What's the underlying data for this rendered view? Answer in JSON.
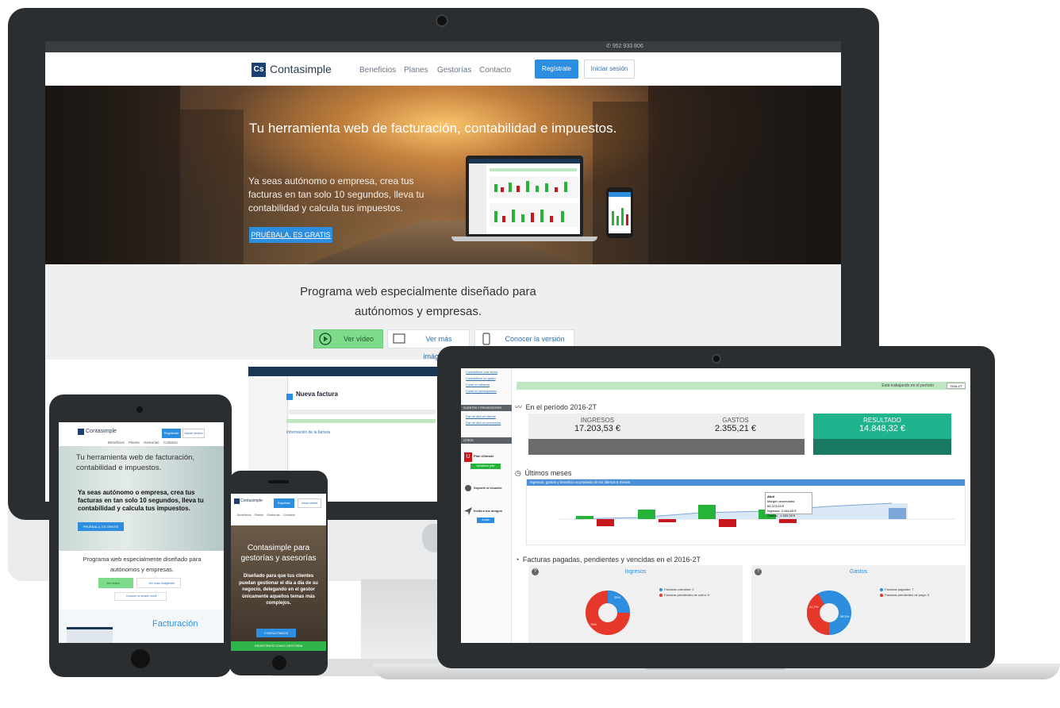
{
  "imac": {
    "top_phone": "952 933 806",
    "brand": "Contasimple",
    "logo_mark": "Cs",
    "nav": [
      "Beneficios",
      "Planes",
      "Gestorías",
      "Contacto"
    ],
    "register_label": "Regístrate",
    "login_label": "Iniciar sesión",
    "hero_title": "Tu herramienta web de facturación, contabilidad e impuestos.",
    "hero_sub": "Ya seas autónomo o empresa, crea tus facturas en tan solo 10 segundos, lleva tu contabilidad y calcula tus impuestos.",
    "hero_cta": "PRUÉBALA, ES GRATIS",
    "band_title_1": "Programa web especialmente diseñado para",
    "band_title_2": "autónomos y empresas.",
    "video_btn": "Ver vídeo",
    "images_btn": "Ver más imágenes",
    "mobile_btn": "Conocer la versión móvil",
    "invoice_title": "Nueva factura",
    "invoice_info": "Información de la factura"
  },
  "macbook": {
    "side_links": [
      "Contabilizar una venta",
      "Contabilizar un gasto",
      "Crear un albarán",
      "Crear un presupuesto"
    ],
    "side_head_clients": "CLIENTES Y PROVEEDORES",
    "side_links_2": [
      "Dar de alta un cliente",
      "Dar de alta un proveedor"
    ],
    "side_head_others": "OTROS",
    "plan_label": "Plan Ultimate",
    "plan_btn": "Actualizar plan",
    "support_label": "Soporte al Usuario",
    "invite_label": "Invita a tus amigos",
    "invite_btn": "Invitar",
    "period_bar": "Está trabajando en el período",
    "period_value": "2016-2T",
    "period_title": "En el período 2016-2T",
    "cards": [
      {
        "label": "INGRESOS",
        "value": "17.203,53 €"
      },
      {
        "label": "GASTOS",
        "value": "2.355,21 €"
      },
      {
        "label": "RESULTADO",
        "value": "14.848,32 €"
      }
    ],
    "months_title": "Últimos meses",
    "chart_title": "Ingresos, gastos y beneficio acumulado de los últimos 6 meses",
    "tooltip": {
      "month": "Abril",
      "l1": "Margen acumulado: 84.374,63 €",
      "l2": "Ingresos: 3.164,63 €",
      "l3": "Gastos: -1.009,00 €"
    },
    "invoices_title": "Facturas pagadas, pendientes y vencidas en el 2016-2T",
    "pie1": {
      "title": "Ingresos",
      "legend": [
        "Facturas cobradas: 2",
        "Facturas pendientes de cobro: 6"
      ],
      "label_a": "25%",
      "label_b": "75%"
    },
    "pie2": {
      "title": "Gastos",
      "legend": [
        "Facturas pagadas: 7",
        "Facturas pendientes de pago: 5"
      ],
      "label_a": "41,7%",
      "label_b": "58,3%"
    }
  },
  "tablet": {
    "brand": "Contasimple",
    "register_label": "Regístrate",
    "login_label": "Iniciar sesión",
    "nav": [
      "Beneficios",
      "Planes",
      "Gestorías",
      "Contacto"
    ],
    "hero_title": "Tu herramienta web de facturación, contabilidad e impuestos.",
    "hero_sub": "Ya seas autónomo o empresa, crea tus facturas en tan solo 10 segundos, lleva tu contabilidad y calcula tus impuestos.",
    "hero_cta": "PRUÉBALA, ES GRATIS",
    "band_title": "Programa web especialmente diseñado para autónomos y empresas.",
    "video_btn": "Ver vídeo",
    "images_btn": "Ver más imágenes",
    "mobile_btn": "Conocer la versión móvil",
    "section_title": "Facturación"
  },
  "phone": {
    "brand": "Contasimple",
    "register_label": "Regístrate",
    "login_label": "Iniciar sesión",
    "nav": [
      "Beneficios",
      "Planes",
      "Gestorías",
      "Contacto"
    ],
    "hero_title": "Contasimple para gestorías y asesorías",
    "hero_sub": "Diseñado para que tus clientes puedan gestionar el día a día de su negocio, delegando en el gestor únicamente aquellos temas más complejos.",
    "cta": "CONTÁCTANOS",
    "cta2": "REGÍSTRATE COMO GESTORÍA"
  },
  "colors": {
    "accent": "#2d8ee0",
    "success": "#7fdb8c",
    "result": "#1fb38e",
    "negative": "#c8181e",
    "positive": "#26b33a"
  }
}
